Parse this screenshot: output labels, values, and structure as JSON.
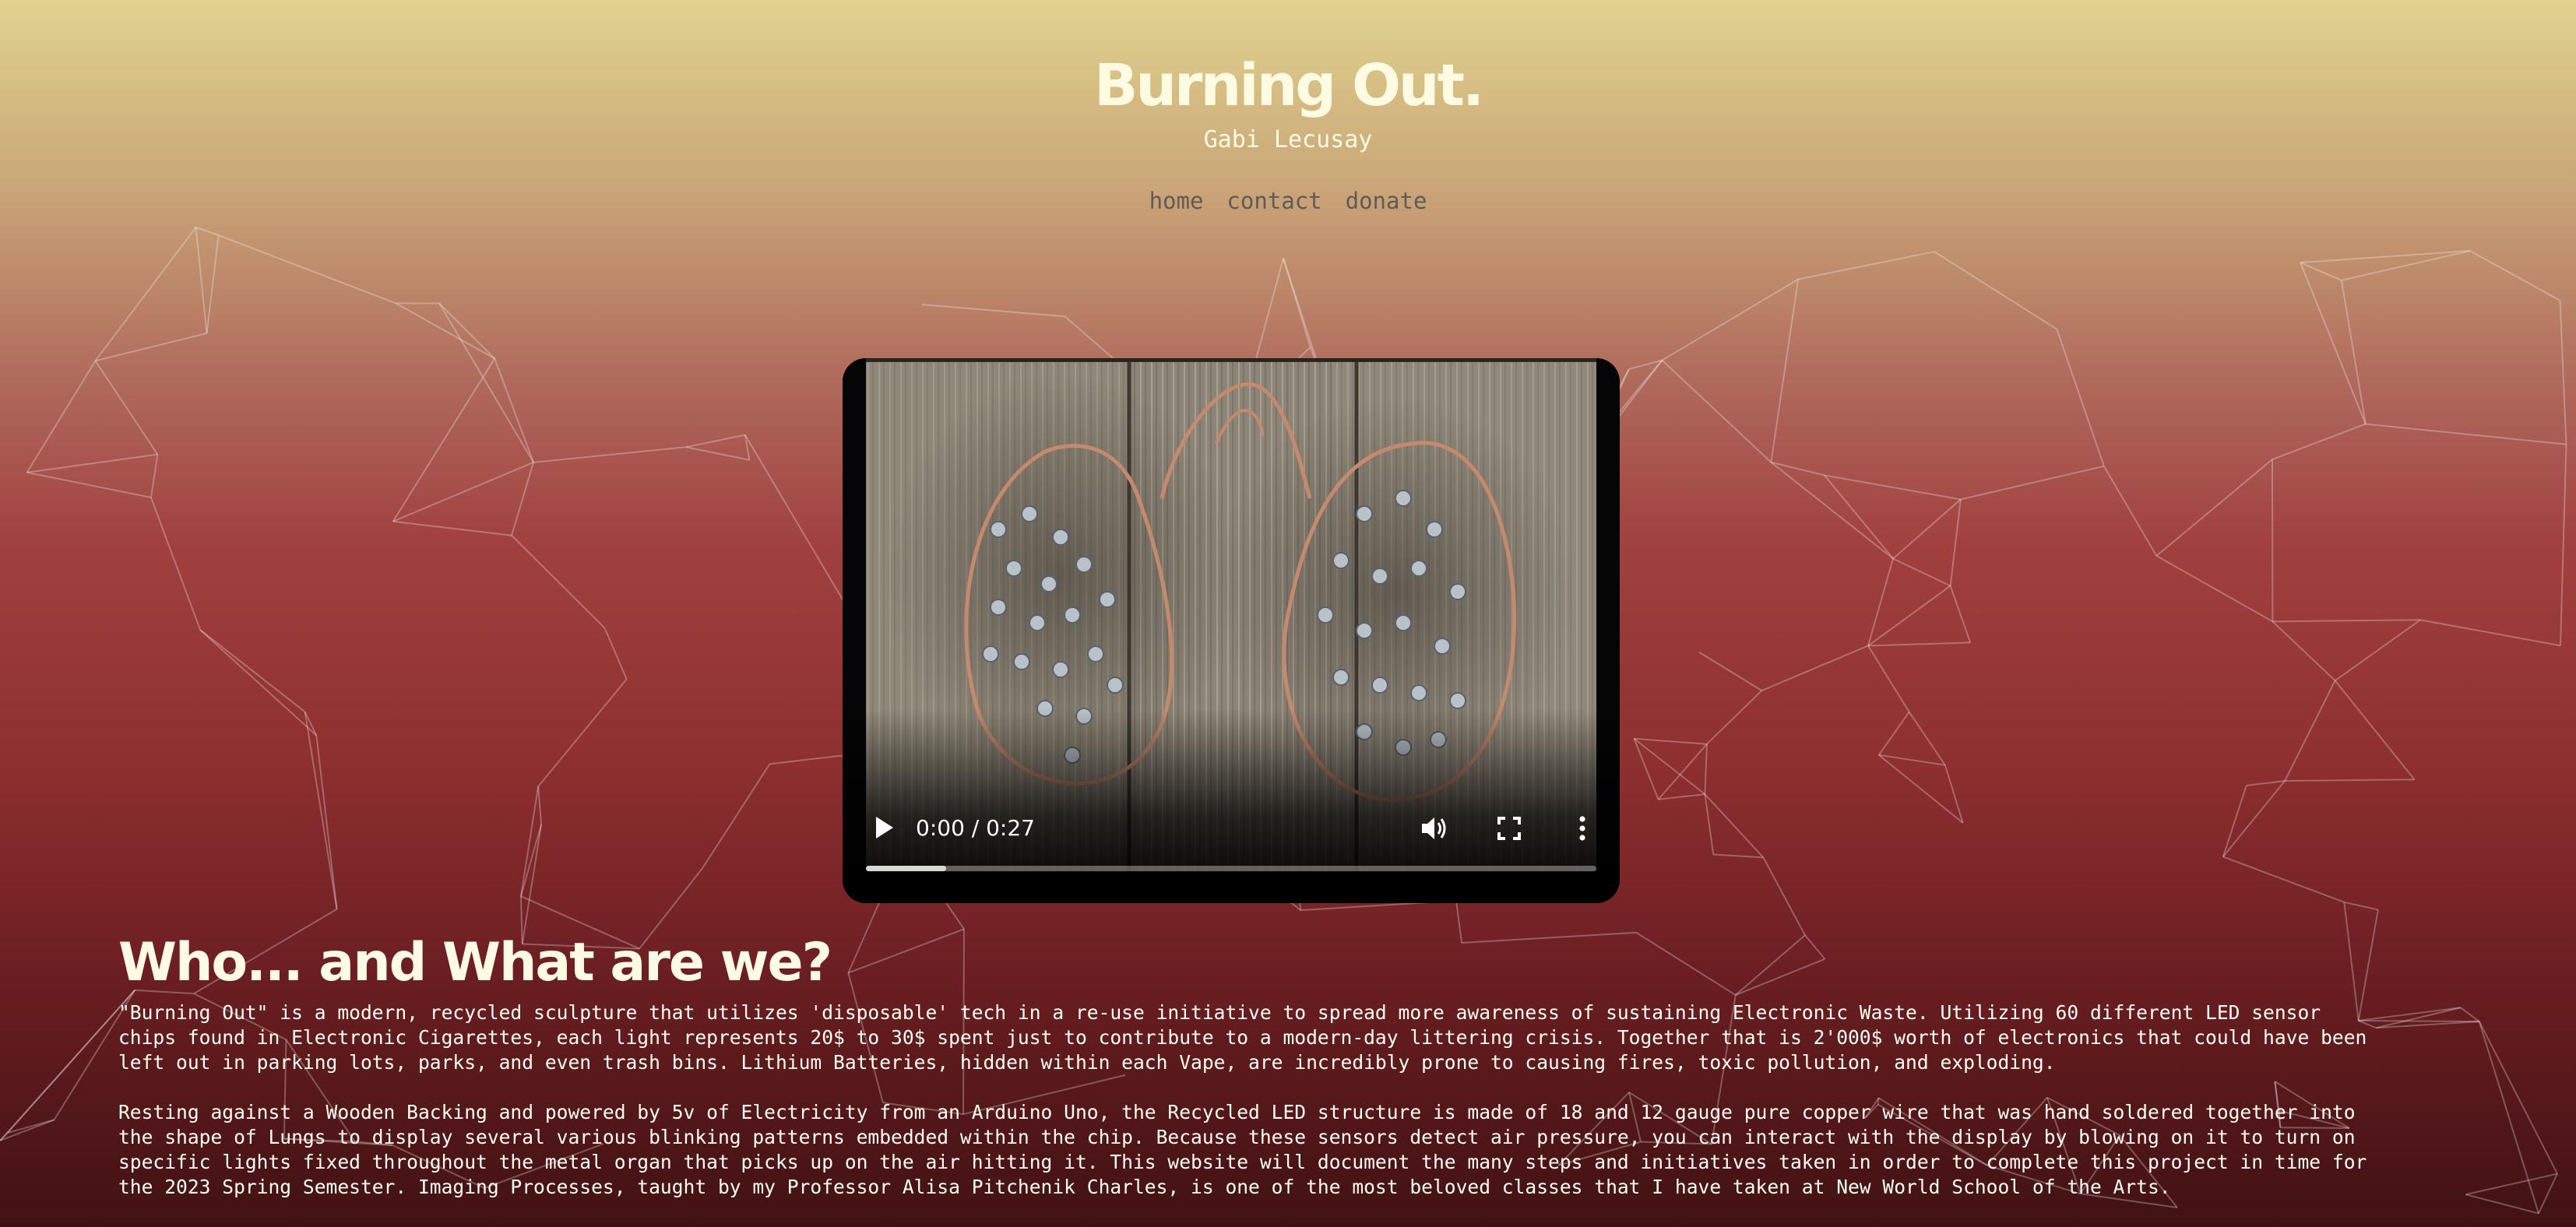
{
  "site": {
    "title": "Burning Out.",
    "author": "Gabi Lecusay"
  },
  "nav": [
    {
      "label": "home"
    },
    {
      "label": "contact"
    },
    {
      "label": "donate"
    }
  ],
  "video": {
    "time": "0:00 / 0:27",
    "progress": 0.11,
    "icons": [
      "play-icon",
      "volume-icon",
      "fullscreen-icon",
      "more-options-icon"
    ]
  },
  "about": {
    "heading": "Who... and What are we?",
    "paragraphs": [
      "\"Burning Out\" is a modern, recycled sculpture that utilizes 'disposable' tech in a re-use initiative to spread more awareness of sustaining Electronic Waste. Utilizing 60 different LED sensor chips found in Electronic Cigarettes, each light represents 20$ to 30$ spent just to contribute to a modern-day littering crisis. Together that is 2'000$ worth of electronics that could have been left out in parking lots, parks, and even trash bins. Lithium Batteries, hidden within each Vape, are incredibly prone to causing fires, toxic pollution, and exploding.",
      "Resting against a Wooden Backing and powered by 5v of Electricity from an Arduino Uno, the Recycled LED structure is made of 18 and 12 gauge pure copper wire that was hand soldered together into the shape of Lungs to display several various blinking patterns embedded within the chip. Because these sensors detect air pressure, you can interact with the display by blowing on it to turn on specific lights fixed throughout the metal organ that picks up on the air hitting it. This website will document the many steps and initiatives taken in order to complete this project in time for the 2023 Spring Semester. Imaging Processes, taught by my Professor Alisa Pitchenik Charles, is one of the most beloved classes that I have taken at New World School of the Arts."
    ]
  },
  "colors": {
    "gradient_top": "#e0d38e",
    "gradient_mid": "#a1403f",
    "gradient_bottom": "#401114",
    "title": "#fffbe3",
    "nav": "#5f5b56"
  }
}
